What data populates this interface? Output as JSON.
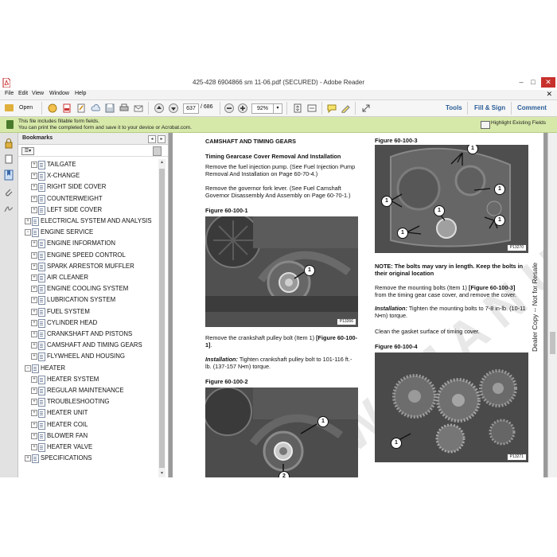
{
  "window": {
    "title": "425-428 6904866 sm 11-06.pdf (SECURED) - Adobe Reader"
  },
  "menu": [
    "File",
    "Edit",
    "View",
    "Window",
    "Help"
  ],
  "toolbar": {
    "open_label": "Open",
    "page_current": "637",
    "page_total": "/ 686",
    "zoom": "92%",
    "tools_label": "Tools",
    "fill_sign_label": "Fill & Sign",
    "comment_label": "Comment"
  },
  "notice": {
    "line1": "This file includes fillable form fields.",
    "line2": "You can print the completed form and save it to your device or Acrobat.com.",
    "highlight_label": "Highlight Existing Fields"
  },
  "bookmarks": {
    "header": "Bookmarks",
    "items": [
      {
        "label": "TAILGATE",
        "level": 2
      },
      {
        "label": "X-CHANGE",
        "level": 2
      },
      {
        "label": "RIGHT SIDE COVER",
        "level": 2
      },
      {
        "label": "COUNTERWEIGHT",
        "level": 2
      },
      {
        "label": "LEFT SIDE COVER",
        "level": 2
      },
      {
        "label": "ELECTRICAL SYSTEM AND ANALYSIS",
        "level": 1
      },
      {
        "label": "ENGINE SERVICE",
        "level": 1
      },
      {
        "label": "ENGINE INFORMATION",
        "level": 2
      },
      {
        "label": "ENGINE SPEED CONTROL",
        "level": 2
      },
      {
        "label": "SPARK ARRESTOR MUFFLER",
        "level": 2
      },
      {
        "label": "AIR CLEANER",
        "level": 2
      },
      {
        "label": "ENGINE COOLING SYSTEM",
        "level": 2
      },
      {
        "label": "LUBRICATION SYSTEM",
        "level": 2
      },
      {
        "label": "FUEL SYSTEM",
        "level": 2
      },
      {
        "label": "CYLINDER HEAD",
        "level": 2
      },
      {
        "label": "CRANKSHAFT AND PISTONS",
        "level": 2
      },
      {
        "label": "CAMSHAFT AND TIMING GEARS",
        "level": 2
      },
      {
        "label": "FLYWHEEL AND HOUSING",
        "level": 2
      },
      {
        "label": "HEATER",
        "level": 1
      },
      {
        "label": "HEATER SYSTEM",
        "level": 2
      },
      {
        "label": "REGULAR MAINTENANCE",
        "level": 2
      },
      {
        "label": "TROUBLESHOOTING",
        "level": 2
      },
      {
        "label": "HEATER UNIT",
        "level": 2
      },
      {
        "label": "HEATER COIL",
        "level": 2
      },
      {
        "label": "BLOWER FAN",
        "level": 2
      },
      {
        "label": "HEATER VALVE",
        "level": 2
      },
      {
        "label": "SPECIFICATIONS",
        "level": 1
      }
    ]
  },
  "document": {
    "section_title": "CAMSHAFT AND TIMING GEARS",
    "subheading": "Timing Gearcase Cover Removal And Installation",
    "para1": "Remove the fuel injection pump. (See Fuel Injection Pump Removal And Installation on Page 60-70-4.)",
    "para2": "Remove the governor fork lever. (See Fuel Camshaft Governor Disassembly And Assembly on Page 60-70-1.)",
    "fig1_title": "Figure 60-100-1",
    "fig1_code": "P13266",
    "para3a": "Remove the crankshaft pulley bolt (Item 1) ",
    "para3b": "[Figure 60-100-1]",
    "para3c": ".",
    "install1_label": "Installation:",
    "install1_text": " Tighten crankshaft pulley bolt to 101-116 ft.-lb. (137-157 N•m) torque.",
    "fig2_title": "Figure 60-100-2",
    "fig3_title": "Figure 60-100-3",
    "fig3_code": "P13270",
    "note_label": "NOTE:",
    "note_text": "The bolts may vary in length. Keep the bolts in their original location",
    "para4a": "Remove the mounting bolts (Item 1) ",
    "para4b": "[Figure 60-100-3]",
    "para4c": " from the timing gear case cover, and remove the cover.",
    "install2_label": "Installation:",
    "install2_text": " Tighten the mounting bolts to 7-8 in-lb. (10-11 N•m) torque.",
    "para5": "Clean the gasket surface of timing cover.",
    "fig4_title": "Figure 60-100-4",
    "fig4_code": "P13271",
    "side_text": "Dealer Copy -- Not for Resale",
    "callout": "1",
    "callout2": "2"
  }
}
